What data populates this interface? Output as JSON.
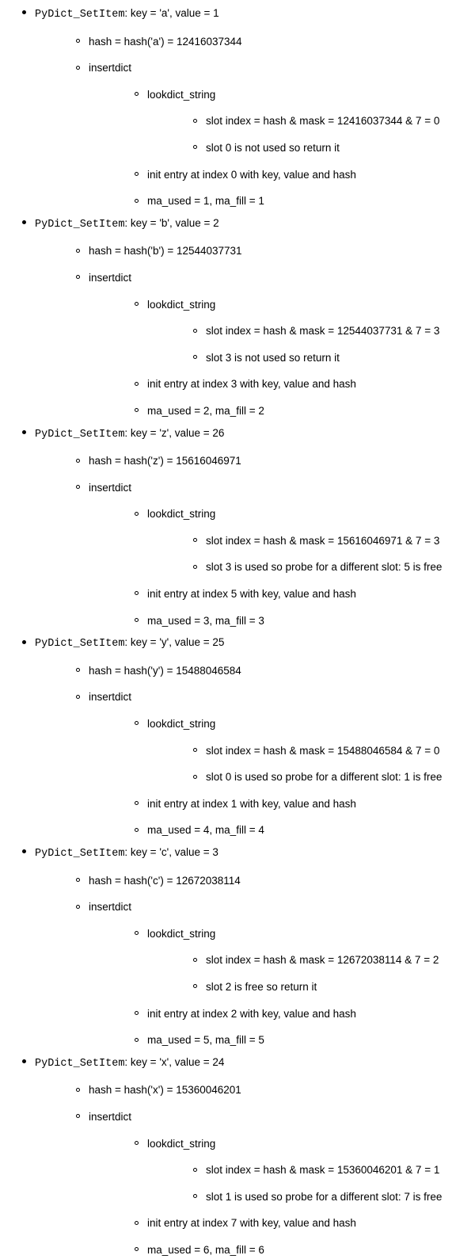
{
  "fn_label": "PyDict_SetItem",
  "hash_label_prefix": "hash = hash(",
  "hash_label_suffix": ") = ",
  "insertdict_label": "insertdict",
  "lookdict_label": "lookdict_string",
  "slot_prefix": "slot index = hash & mask = ",
  "slot_middle": " & 7 = ",
  "init_prefix": "init entry at index ",
  "init_suffix": " with key, value and hash",
  "ma_prefix": "ma_used = ",
  "ma_middle": ", ma_fill = ",
  "items": [
    {
      "key": "'a'",
      "value": "1",
      "hash_key": "'a'",
      "hash_val": "12416037344",
      "slot_hash": "12416037344",
      "slot_idx": "0",
      "slot_note": "slot 0 is not used so return it",
      "init_idx": "0",
      "ma_used": "1",
      "ma_fill": "1"
    },
    {
      "key": "'b'",
      "value": "2",
      "hash_key": "'b'",
      "hash_val": "12544037731",
      "slot_hash": "12544037731",
      "slot_idx": "3",
      "slot_note": "slot 3 is not used so return it",
      "init_idx": "3",
      "ma_used": "2",
      "ma_fill": "2"
    },
    {
      "key": "'z'",
      "value": "26",
      "hash_key": "'z'",
      "hash_val": "15616046971",
      "slot_hash": "15616046971",
      "slot_idx": "3",
      "slot_note": "slot 3 is used so probe for a different slot: 5 is free",
      "init_idx": "5",
      "ma_used": "3",
      "ma_fill": "3"
    },
    {
      "key": "'y'",
      "value": "25",
      "hash_key": "'y'",
      "hash_val": "15488046584",
      "slot_hash": "15488046584",
      "slot_idx": "0",
      "slot_note": "slot 0 is used so probe for a different slot: 1 is free",
      "init_idx": "1",
      "ma_used": "4",
      "ma_fill": "4"
    },
    {
      "key": "'c'",
      "value": "3",
      "hash_key": "'c'",
      "hash_val": "12672038114",
      "slot_hash": "12672038114",
      "slot_idx": "2",
      "slot_note": "slot 2 is free so return it",
      "init_idx": "2",
      "ma_used": "5",
      "ma_fill": "5"
    },
    {
      "key": "'x'",
      "value": "24",
      "hash_key": "'x'",
      "hash_val": "15360046201",
      "slot_hash": "15360046201",
      "slot_idx": "1",
      "slot_note": "slot 1 is used so probe for a different slot: 7 is free",
      "init_idx": "7",
      "ma_used": "6",
      "ma_fill": "6"
    }
  ]
}
